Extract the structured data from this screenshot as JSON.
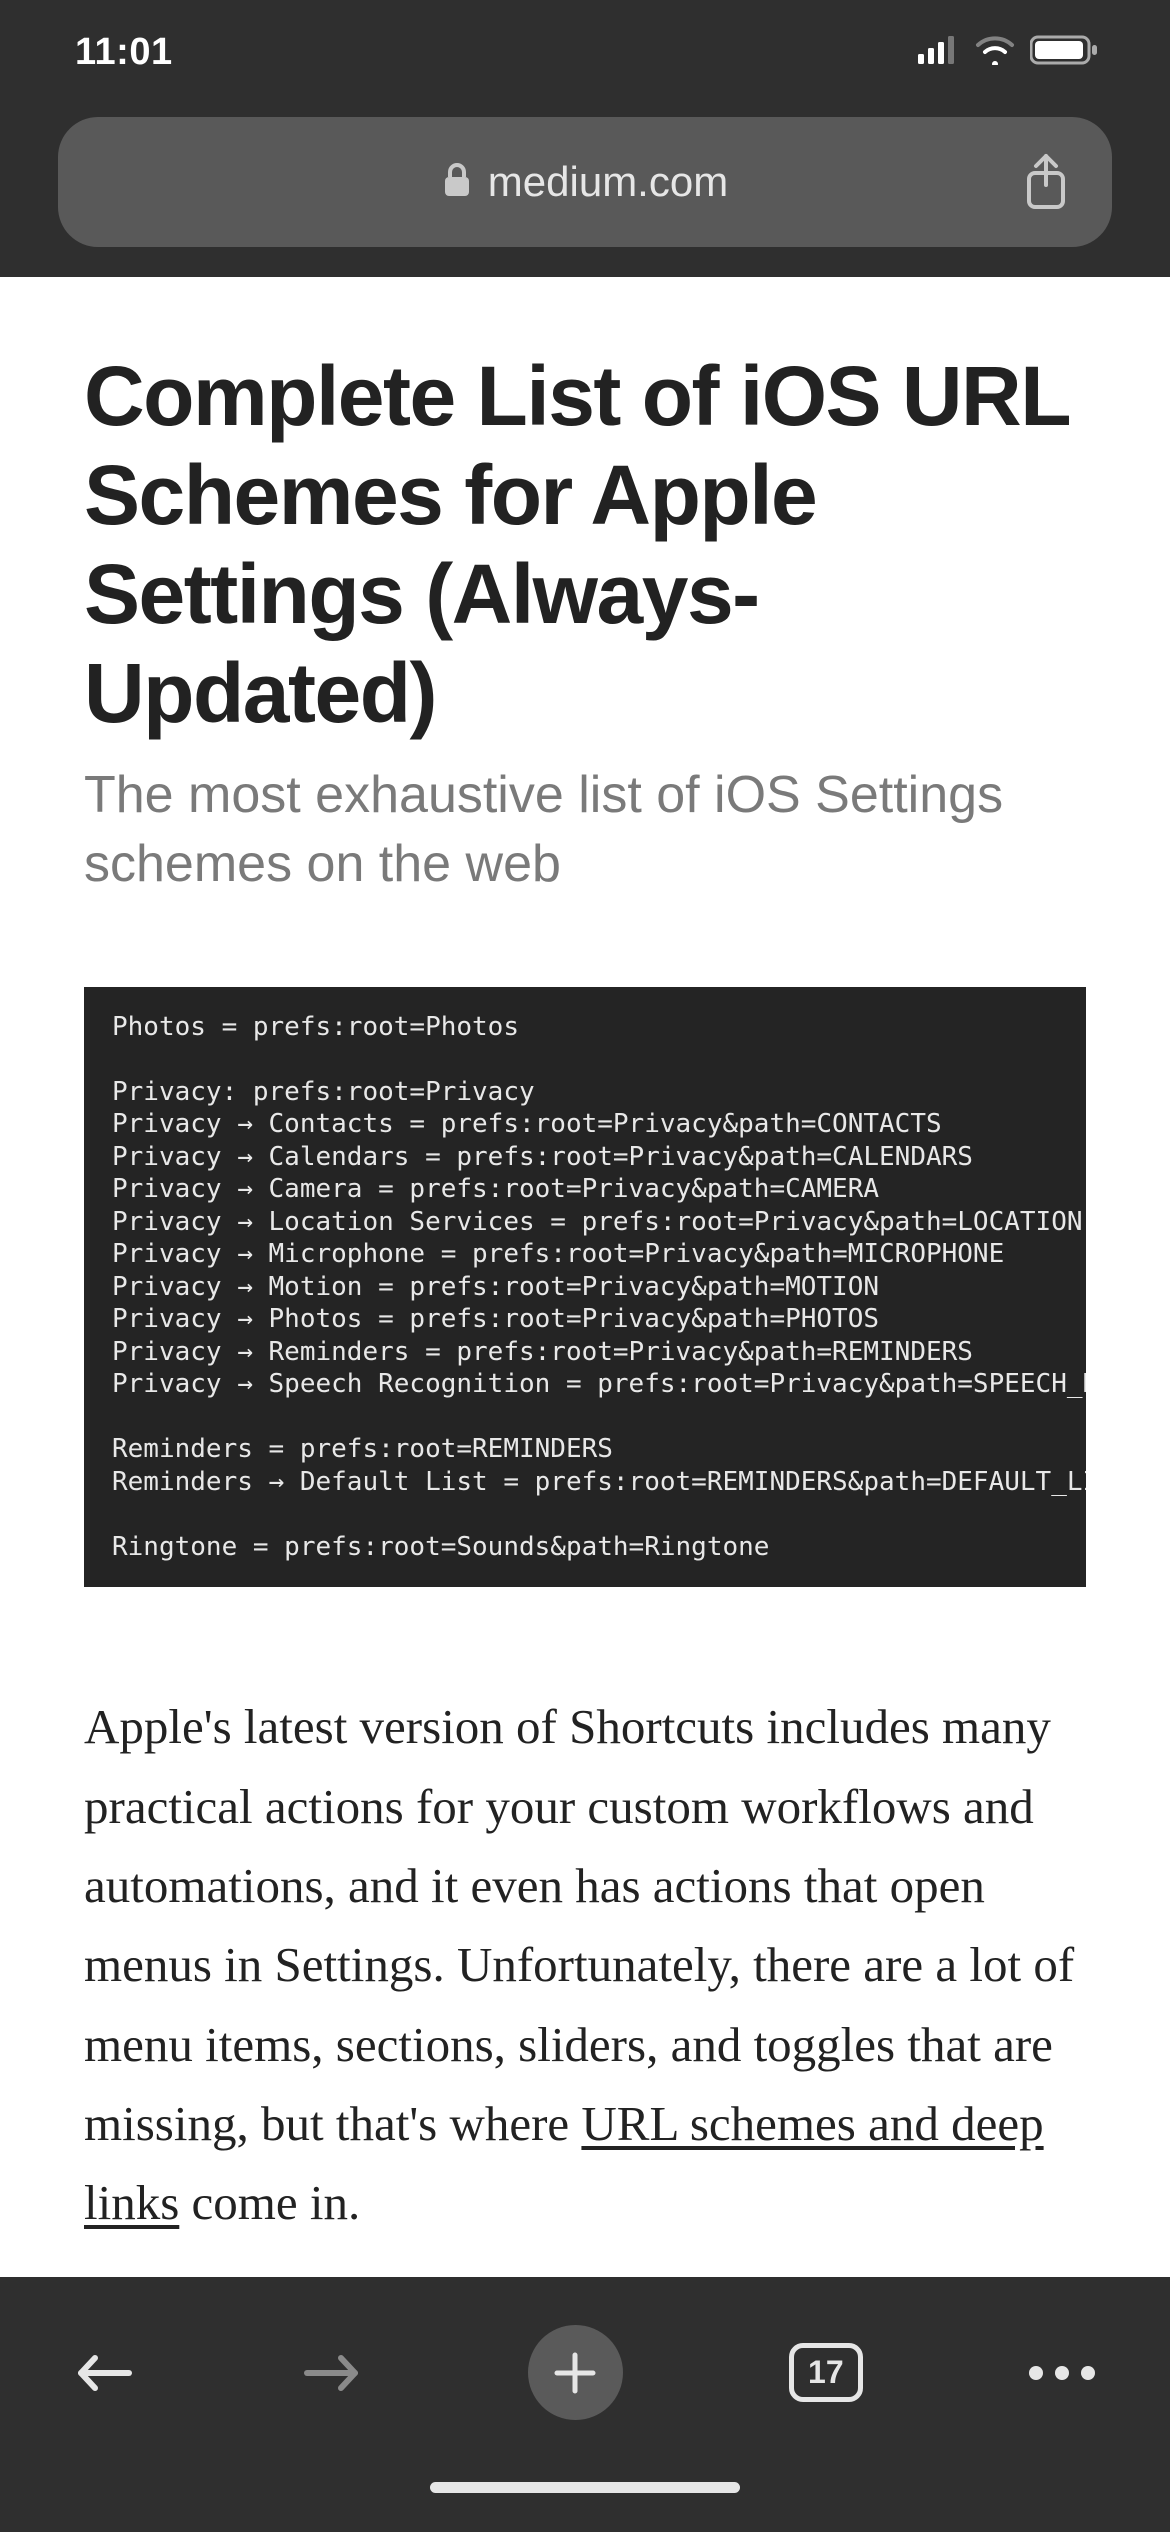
{
  "status": {
    "time": "11:01"
  },
  "urlbar": {
    "domain": "medium.com"
  },
  "article": {
    "title": "Complete List of iOS URL Schemes for Apple Settings (Always-Updated)",
    "subtitle": "The most exhaustive list of iOS Settings schemes on the web",
    "code": "Photos = prefs:root=Photos\n\nPrivacy: prefs:root=Privacy\nPrivacy → Contacts = prefs:root=Privacy&path=CONTACTS\nPrivacy → Calendars = prefs:root=Privacy&path=CALENDARS\nPrivacy → Camera = prefs:root=Privacy&path=CAMERA\nPrivacy → Location Services = prefs:root=Privacy&path=LOCATION\nPrivacy → Microphone = prefs:root=Privacy&path=MICROPHONE\nPrivacy → Motion = prefs:root=Privacy&path=MOTION\nPrivacy → Photos = prefs:root=Privacy&path=PHOTOS\nPrivacy → Reminders = prefs:root=Privacy&path=REMINDERS\nPrivacy → Speech Recognition = prefs:root=Privacy&path=SPEECH_RECOGNI\n\nReminders = prefs:root=REMINDERS\nReminders → Default List = prefs:root=REMINDERS&path=DEFAULT_LIST\n\nRingtone = prefs:root=Sounds&path=Ringtone",
    "body_before_link": "Apple's latest version of Shortcuts includes many practical actions for your custom workflows and automations, and it even has actions that open menus in Settings. Unfortunately, there are a lot of menu items, sections, sliders, and toggles that are missing, but that's where ",
    "link_text": "URL schemes and deep links",
    "body_after_link": " come in."
  },
  "toolbar": {
    "tab_count": "17"
  }
}
